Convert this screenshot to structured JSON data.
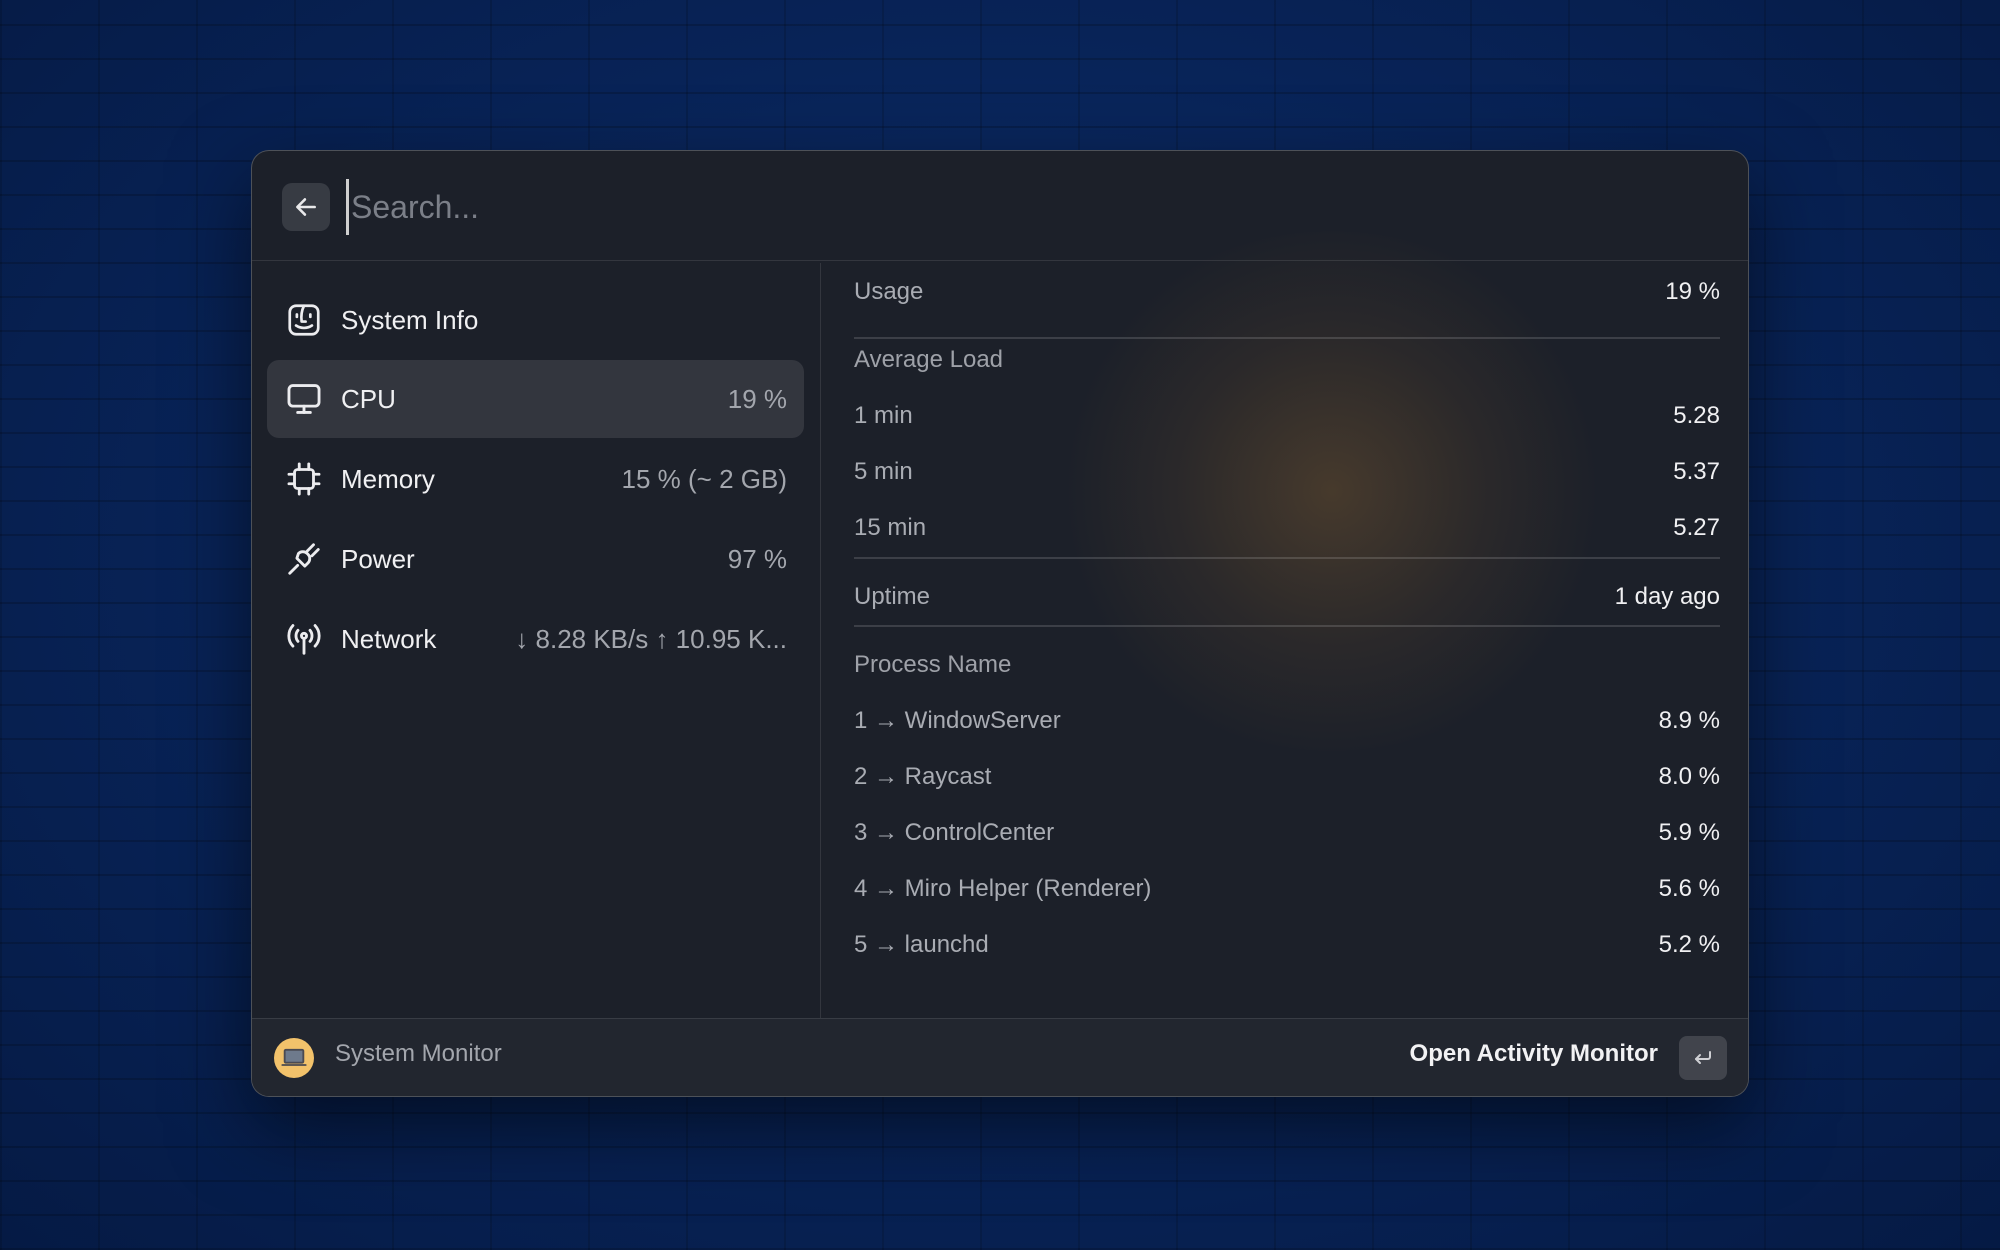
{
  "search": {
    "placeholder": "Search..."
  },
  "icons": {
    "back": "arrow-left-icon",
    "system_info": "finder-icon",
    "cpu": "monitor-icon",
    "memory": "chip-icon",
    "power": "plug-icon",
    "network": "antenna-icon",
    "extension": "laptop-icon",
    "enter": "return-key-icon"
  },
  "sidebar": {
    "items": [
      {
        "label": "System Info",
        "value": ""
      },
      {
        "label": "CPU",
        "value": "19 %"
      },
      {
        "label": "Memory",
        "value": "15 % (~ 2 GB)"
      },
      {
        "label": "Power",
        "value": "97 %"
      },
      {
        "label": "Network",
        "value": "↓ 8.28 KB/s ↑ 10.95 K..."
      }
    ],
    "selected_index": 1
  },
  "detail": {
    "usage": {
      "label": "Usage",
      "value": "19 %"
    },
    "average_load": {
      "header": "Average Load",
      "rows": [
        {
          "label": "1 min",
          "value": "5.28"
        },
        {
          "label": "5 min",
          "value": "5.37"
        },
        {
          "label": "15 min",
          "value": "5.27"
        }
      ]
    },
    "uptime": {
      "label": "Uptime",
      "value": "1 day ago"
    },
    "processes": {
      "header": "Process Name",
      "rows": [
        {
          "label": "1 → WindowServer",
          "value": "8.9 %"
        },
        {
          "label": "2 → Raycast",
          "value": "8.0 %"
        },
        {
          "label": "3 → ControlCenter",
          "value": "5.9 %"
        },
        {
          "label": "4 → Miro Helper (Renderer)",
          "value": "5.6 %"
        },
        {
          "label": "5 → launchd",
          "value": "5.2 %"
        }
      ]
    }
  },
  "footer": {
    "title": "System Monitor",
    "action": "Open Activity Monitor",
    "enter_symbol": "↵"
  },
  "colors": {
    "background": "#0a2350",
    "window": "#1c2029",
    "accent_icon": "#f2c26b"
  }
}
